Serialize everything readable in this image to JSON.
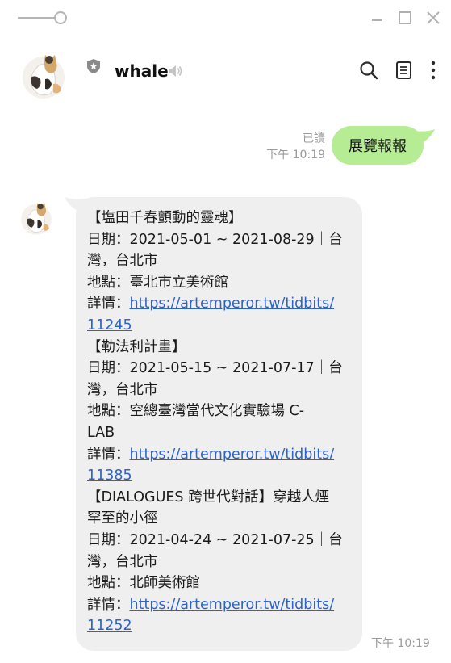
{
  "window": {
    "title_bar_icons": [
      "slider-icon",
      "minimize-icon",
      "maximize-icon",
      "close-icon"
    ]
  },
  "header": {
    "title": "whale",
    "icons": [
      "shield-icon",
      "speaker-icon",
      "search-icon",
      "notes-icon",
      "more-icon"
    ]
  },
  "messages": {
    "outgoing": {
      "text": "展覽報報",
      "read_label": "已讀",
      "time": "下午 10:19",
      "bubble_color": "#b6ec94"
    },
    "incoming": {
      "time": "下午 10:19",
      "bubble_color": "#efefef",
      "link_color": "#2d63c8",
      "lines": [
        {
          "text": "【塩田千春顫動的靈魂】"
        },
        {
          "text": "日期：2021-05-01 ~ 2021-08-29｜台"
        },
        {
          "text": "灣，台北市"
        },
        {
          "text": "地點：臺北市立美術館"
        },
        {
          "prefix": "詳情：",
          "link": "https://artemperor.tw/tidbits/"
        },
        {
          "link": "11245"
        },
        {
          "text": "【勒法利計畫】"
        },
        {
          "text": "日期：2021-05-15 ~ 2021-07-17｜台"
        },
        {
          "text": "灣，台北市"
        },
        {
          "text": "地點：空總臺灣當代文化實驗場 C-"
        },
        {
          "text": "LAB"
        },
        {
          "prefix": "詳情：",
          "link": "https://artemperor.tw/tidbits/"
        },
        {
          "link": "11385"
        },
        {
          "text": "【DIALOGUES 跨世代對話】穿越人煙"
        },
        {
          "text": "罕至的小徑"
        },
        {
          "text": "日期：2021-04-24 ~ 2021-07-25｜台"
        },
        {
          "text": "灣，台北市"
        },
        {
          "text": "地點：北師美術館"
        },
        {
          "prefix": "詳情：",
          "link": "https://artemperor.tw/tidbits/"
        },
        {
          "link": "11252"
        }
      ]
    }
  }
}
